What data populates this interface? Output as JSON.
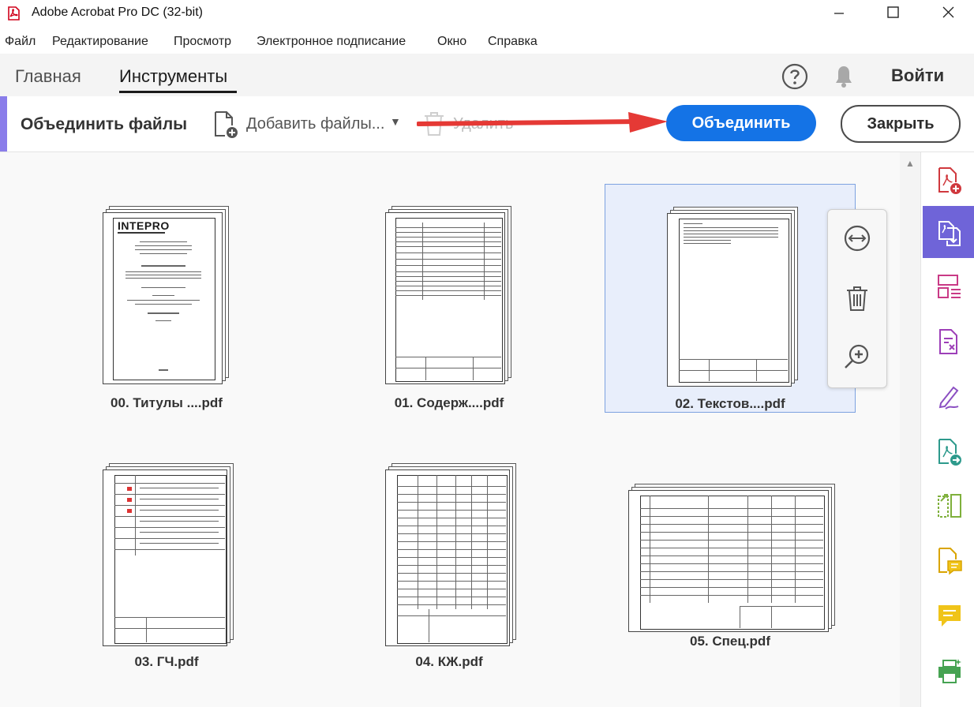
{
  "window": {
    "title": "Adobe Acrobat Pro DC (32-bit)"
  },
  "menu": [
    "Файл",
    "Редактирование",
    "Просмотр",
    "Электронное подписание",
    "Окно",
    "Справка"
  ],
  "tabs": {
    "home": "Главная",
    "tools": "Инструменты"
  },
  "header": {
    "sign_in": "Войти"
  },
  "toolbar": {
    "title": "Объединить файлы",
    "add_files": "Добавить файлы...",
    "delete": "Удалить",
    "combine": "Объединить",
    "close": "Закрыть"
  },
  "files": [
    {
      "name": "00. Титулы ....pdf",
      "logo": "INTEPRO"
    },
    {
      "name": "01. Содерж....pdf"
    },
    {
      "name": "02. Текстов....pdf",
      "selected": true
    },
    {
      "name": "03. ГЧ.pdf"
    },
    {
      "name": "04. КЖ.pdf"
    },
    {
      "name": "05. Спец.pdf"
    }
  ],
  "card_actions": [
    "expand-icon",
    "trash-icon",
    "zoom-in-icon"
  ],
  "right_rail": [
    "create-pdf-icon",
    "combine-files-icon",
    "organize-pages-icon",
    "edit-pdf-icon",
    "fill-sign-icon",
    "export-pdf-icon",
    "compare-icon",
    "comment-file-icon",
    "comment-icon",
    "print-production-icon"
  ],
  "colors": {
    "accent": "#1473e6",
    "rail_active": "#6f64d8",
    "toolbar_accent": "#8a7dea",
    "selection": "#e8eefb",
    "annotation_arrow": "#e53935"
  }
}
